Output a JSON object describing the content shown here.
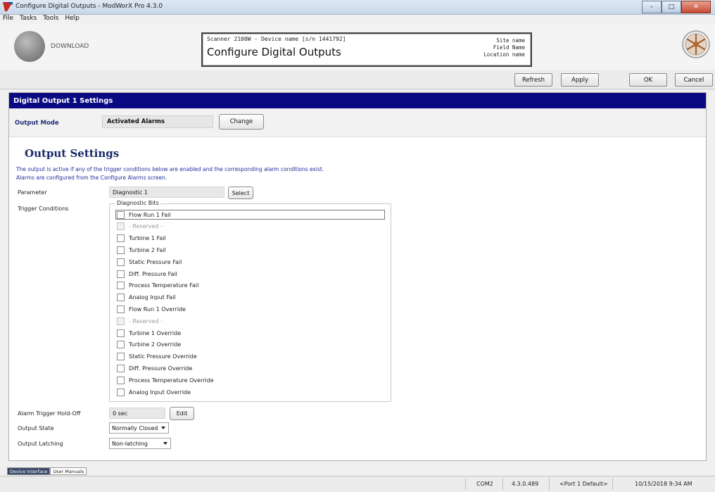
{
  "window": {
    "title": "Configure Digital Outputs - ModWorX Pro 4.3.0"
  },
  "menu": [
    "File",
    "Tasks",
    "Tools",
    "Help"
  ],
  "header": {
    "download_label": "DOWNLOAD",
    "device_line": "Scanner 2100W - Device name [s/n 1441792]",
    "screen_title": "Configure Digital Outputs",
    "site_name": "Site name",
    "field_name": "Field Name",
    "location_name": "Location name"
  },
  "toolbar": {
    "refresh": "Refresh",
    "apply": "Apply",
    "ok": "OK",
    "cancel": "Cancel"
  },
  "section": {
    "title": "Digital Output 1 Settings"
  },
  "output_mode": {
    "label": "Output Mode",
    "value": "Activated Alarms",
    "change": "Change"
  },
  "output_settings": {
    "title": "Output Settings",
    "desc1": "The output is active if any of the trigger conditions below are enabled and the corresponding alarm conditions exist.",
    "desc2": "Alarms are configured from the Configure Alarms screen."
  },
  "parameter": {
    "label": "Parameter",
    "value": "Diagnostic 1",
    "select": "Select"
  },
  "trigger": {
    "label": "Trigger Conditions",
    "group_title": "Diagnostic Bits",
    "items": [
      {
        "label": "Flow Run 1 Fail",
        "disabled": false
      },
      {
        "label": "- Reserved -",
        "disabled": true
      },
      {
        "label": "Turbine 1 Fail",
        "disabled": false
      },
      {
        "label": "Turbine 2 Fail",
        "disabled": false
      },
      {
        "label": "Static Pressure Fail",
        "disabled": false
      },
      {
        "label": "Diff. Pressure Fail",
        "disabled": false
      },
      {
        "label": "Process Temperature Fail",
        "disabled": false
      },
      {
        "label": "Analog Input Fail",
        "disabled": false
      },
      {
        "label": "Flow Run 1 Override",
        "disabled": false
      },
      {
        "label": "- Reserved -",
        "disabled": true
      },
      {
        "label": "Turbine 1 Override",
        "disabled": false
      },
      {
        "label": "Turbine 2 Override",
        "disabled": false
      },
      {
        "label": "Static Pressure Override",
        "disabled": false
      },
      {
        "label": "Diff. Pressure Override",
        "disabled": false
      },
      {
        "label": "Process Temperature Override",
        "disabled": false
      },
      {
        "label": "Analog Input Override",
        "disabled": false
      }
    ]
  },
  "holdoff": {
    "label": "Alarm Trigger Hold-Off",
    "value": "0 sec",
    "edit": "Edit"
  },
  "output_state": {
    "label": "Output State",
    "value": "Normally Closed"
  },
  "output_latching": {
    "label": "Output Latching",
    "value": "Non-latching"
  },
  "tabs": [
    "Device Interface",
    "User Manuals"
  ],
  "status": {
    "port": "COM2",
    "version": "4.3.0.489",
    "profile": "<Port 1 Default>",
    "datetime": "10/15/2018 9:34 AM"
  }
}
